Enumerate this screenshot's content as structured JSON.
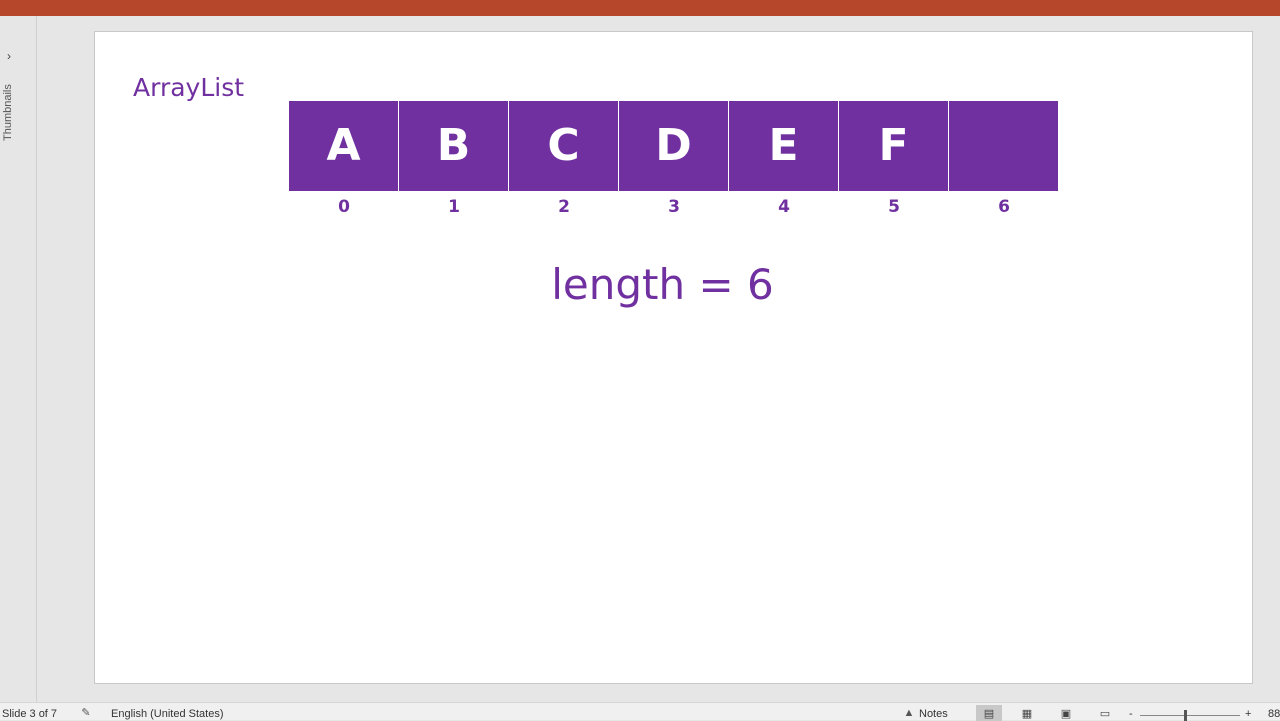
{
  "thumbnails_pane": {
    "label": "Thumbnails",
    "expand_icon": "chevron-right-icon"
  },
  "slide": {
    "title": "ArrayList",
    "cells": [
      "A",
      "B",
      "C",
      "D",
      "E",
      "F",
      ""
    ],
    "indices": [
      "0",
      "1",
      "2",
      "3",
      "4",
      "5",
      "6"
    ],
    "length_text": "length = 6"
  },
  "status_bar": {
    "slide_info": "Slide 3 of 7",
    "language": "English (United States)",
    "notes_label": "Notes",
    "zoom_value": "88",
    "zoom_minus": "-",
    "zoom_plus": "+"
  },
  "colors": {
    "accent": "#7030a0",
    "title_bar": "#b7472a"
  }
}
